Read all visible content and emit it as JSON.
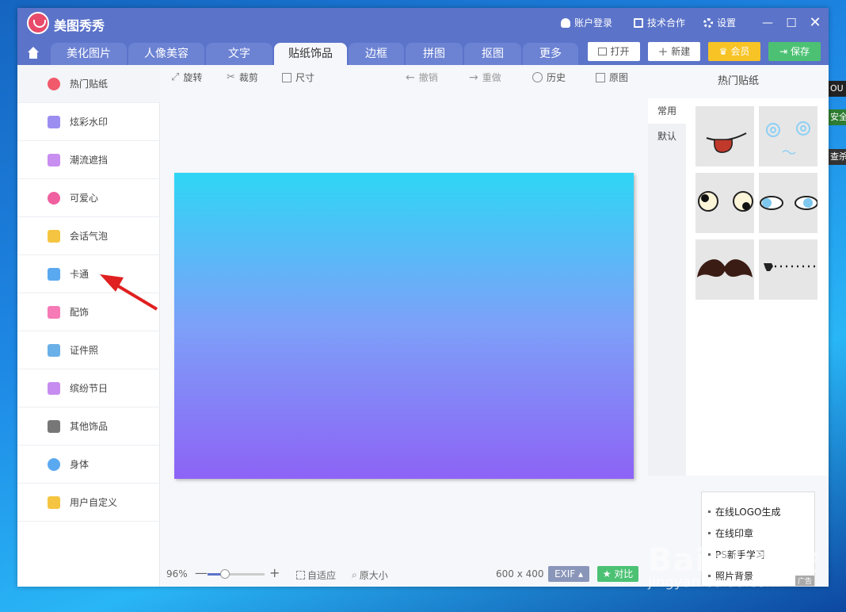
{
  "app": {
    "title": "美图秀秀"
  },
  "titlebar": {
    "login": "账户登录",
    "cooperation": "技术合作",
    "settings": "设置",
    "minimize": "—",
    "maximize": "☐",
    "close": "✕"
  },
  "nav": {
    "tabs": [
      "美化图片",
      "人像美容",
      "文字",
      "贴纸饰品",
      "边框",
      "拼图",
      "抠图",
      "更多"
    ],
    "active": "贴纸饰品",
    "open": "打开",
    "new": "新建",
    "vip": "会员",
    "save": "保存"
  },
  "sidebar": {
    "items": [
      {
        "label": "热门贴纸",
        "icon": "flame-icon",
        "color": "#f05a6b"
      },
      {
        "label": "炫彩水印",
        "icon": "watermark-icon",
        "color": "#9b8ef0"
      },
      {
        "label": "潮流遮挡",
        "icon": "mask-icon",
        "color": "#c88ef0"
      },
      {
        "label": "可爱心",
        "icon": "heart-icon",
        "color": "#f060a0"
      },
      {
        "label": "会话气泡",
        "icon": "chat-bubble-icon",
        "color": "#f5c542"
      },
      {
        "label": "卡通",
        "icon": "cartoon-bear-icon",
        "color": "#5aa8f0"
      },
      {
        "label": "配饰",
        "icon": "bow-icon",
        "color": "#f57ab5"
      },
      {
        "label": "证件照",
        "icon": "id-photo-icon",
        "color": "#6ab0e8"
      },
      {
        "label": "缤纷节日",
        "icon": "balloon-icon",
        "color": "#c78cf0"
      },
      {
        "label": "其他饰品",
        "icon": "grid-icon",
        "color": "#777777"
      },
      {
        "label": "身体",
        "icon": "person-icon",
        "color": "#5aa8f0"
      },
      {
        "label": "用户自定义",
        "icon": "pencil-icon",
        "color": "#f5c542"
      }
    ]
  },
  "toolbar": {
    "rotate": "旋转",
    "crop": "裁剪",
    "size": "尺寸",
    "undo": "撤销",
    "redo": "重做",
    "history": "历史",
    "original": "原图"
  },
  "status": {
    "zoom": "96%",
    "zoom_level": 0.3,
    "minus": "—",
    "plus": "+",
    "fit": "自适应",
    "actual": "原大小",
    "dimensions": "600 x 400",
    "exif": "EXIF ▴",
    "compare": "对比"
  },
  "rpanel": {
    "title": "热门贴纸",
    "categories": [
      "常用",
      "默认"
    ],
    "stickers": [
      "tongue-sticker",
      "dizzy-eyes-sticker",
      "googly-eyes-sticker",
      "blue-eyes-sticker",
      "mustache-sticker",
      "pointer-dots-sticker"
    ],
    "ads": [
      "在线LOGO生成",
      "在线印章",
      "PS新手学习",
      "照片背景"
    ],
    "ad_tag": "广告"
  },
  "desktop": {
    "tabs": [
      "OU",
      "安全",
      "查杀"
    ]
  },
  "watermark": {
    "main": "Baidu经验",
    "sub": "jingyan.baidu.com"
  }
}
